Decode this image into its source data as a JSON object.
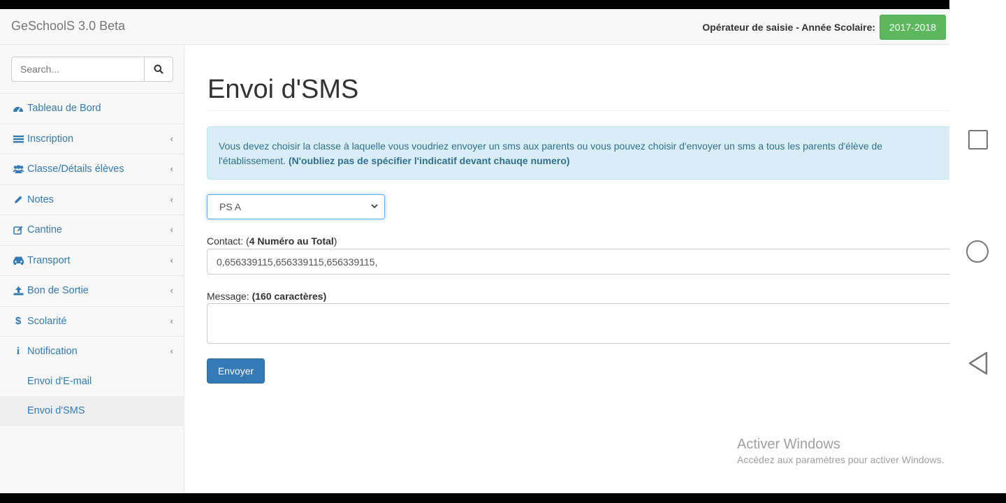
{
  "app": {
    "brand": "GeSchoolS 3.0 Beta"
  },
  "header": {
    "operator_label": "Opérateur de saisie - Année Scolaire:",
    "year": "2017-2018"
  },
  "search": {
    "placeholder": "Search..."
  },
  "sidebar": {
    "items": [
      {
        "label": "Tableau de Bord",
        "icon": "dashboard-icon"
      },
      {
        "label": "Inscription",
        "icon": "list-icon"
      },
      {
        "label": "Classe/Détails élèves",
        "icon": "users-icon"
      },
      {
        "label": "Notes",
        "icon": "pencil-icon"
      },
      {
        "label": "Cantine",
        "icon": "edit-icon"
      },
      {
        "label": "Transport",
        "icon": "car-icon"
      },
      {
        "label": "Bon de Sortie",
        "icon": "upload-icon"
      },
      {
        "label": "Scolarité",
        "icon": "dollar-icon"
      },
      {
        "label": "Notification",
        "icon": "info-icon"
      }
    ],
    "sub_items": [
      {
        "label": "Envoi d'E-mail"
      },
      {
        "label": "Envoi d'SMS"
      }
    ]
  },
  "main": {
    "title": "Envoi d'SMS",
    "alert_text": "Vous devez choisir la classe à laquelle vous voudriez envoyer un sms aux parents ou vous pouvez choisir d'envoyer un sms a tous les parents d'élève de l'établissement.",
    "alert_bold": "(N'oubliez pas de spécifier l'indicatif devant chauqe numero)",
    "class_selected": "PS A",
    "contact_label": "Contact: (",
    "contact_count": "4 Numéro au Total",
    "contact_close": ")",
    "contact_value": "0,656339115,656339115,656339115,",
    "message_label": "Message: ",
    "message_limit": "(160 caractères)",
    "message_value": "",
    "send_label": "Envoyer"
  },
  "watermark": {
    "title": "Activer Windows",
    "subtitle": "Accédez aux paramètres pour activer Windows."
  },
  "colors": {
    "accent": "#337ab7",
    "success": "#5cb85c",
    "info_bg": "#d9edf7"
  }
}
